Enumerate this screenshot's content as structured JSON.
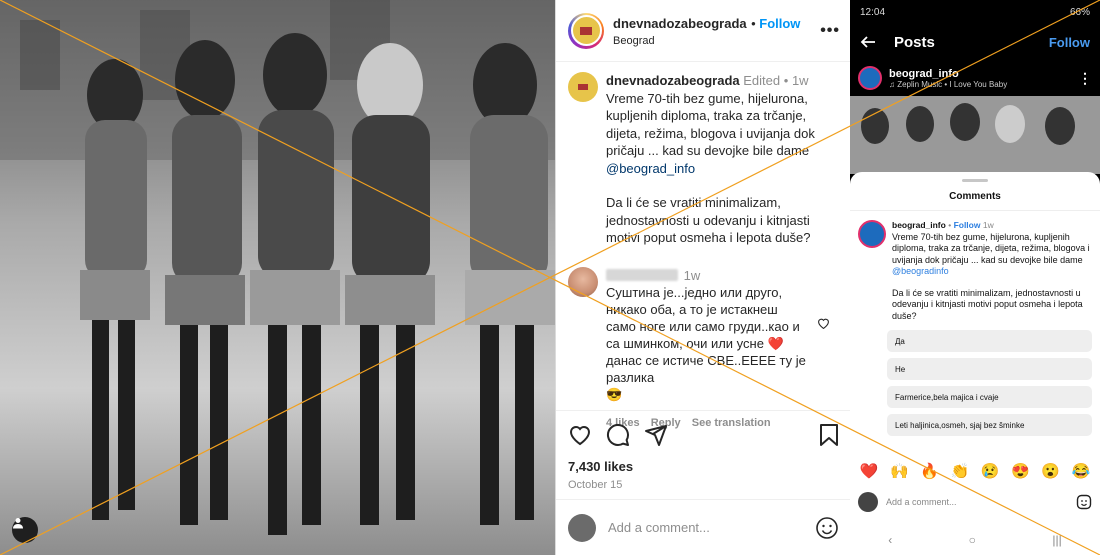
{
  "post": {
    "username": "dnevnadozabeograda",
    "follow_label": "Follow",
    "location": "Beograd",
    "more_glyph": "•••",
    "edited_label": "Edited",
    "caption_time": "1w",
    "caption_text": "Vreme 70-tih bez gume, hijelurona, kupljenih diploma, traka za trčanje, dijeta, režima, blogova i uvijanja dok pričaju ... kad su devojke bile dame",
    "caption_mention": "@beograd_info",
    "caption_question": "Da li će se vratiti minimalizam, jednostavnosti u odevanju i kitnjasti motivi poput osmeha i lepota duše?",
    "likes": "7,430 likes",
    "date": "October 15",
    "add_comment_placeholder": "Add a comment..."
  },
  "comment": {
    "time": "1w",
    "text": "Суштина је...једно или друго, никако оба, а то је истакнеш само ноге или само груди..као и са шминком, очи или усне",
    "heart_emoji": "❤️",
    "text_after": "данас се истиче СВЕ..ЕЕЕЕ ту је разлика",
    "end_emoji": "😎",
    "likes": "4 likes",
    "reply": "Reply",
    "translate": "See translation"
  },
  "mobile": {
    "status_time": "12:04",
    "status_right": "66%",
    "title": "Posts",
    "follow_label": "Follow",
    "account": "beograd_info",
    "music": "♫ Zeplin Music • I Love You Baby",
    "sheet_title": "Comments",
    "post_user": "beograd_info",
    "post_follow": "Follow",
    "post_time": "1w",
    "post_text": "Vreme 70-tih bez gume, hijelurona, kupljenih diploma, traka za trčanje, dijeta, režima, blogova i uvijanja dok pričaju ... kad su devojke bile dame",
    "post_mention": "@beogradinfo",
    "post_question": "Da li će se vratiti minimalizam, jednostavnosti u odevanju i kitnjasti motivi poput osmeha i lepota duše?",
    "comments": [
      "Да",
      "Не",
      "Farmerice,bela majica i cvaje",
      "Leti haljinica,osmeh, sjaj bez šminke"
    ],
    "emojis": [
      "❤️",
      "🙌",
      "🔥",
      "👏",
      "😢",
      "😍",
      "😮",
      "😂"
    ],
    "add_comment_placeholder": "Add a comment...",
    "nav": [
      "‹",
      "○",
      "|||"
    ]
  },
  "colors": {
    "follow_blue": "#0095f6",
    "heart_red": "#ed4956",
    "cross_line": "#f0a020"
  }
}
